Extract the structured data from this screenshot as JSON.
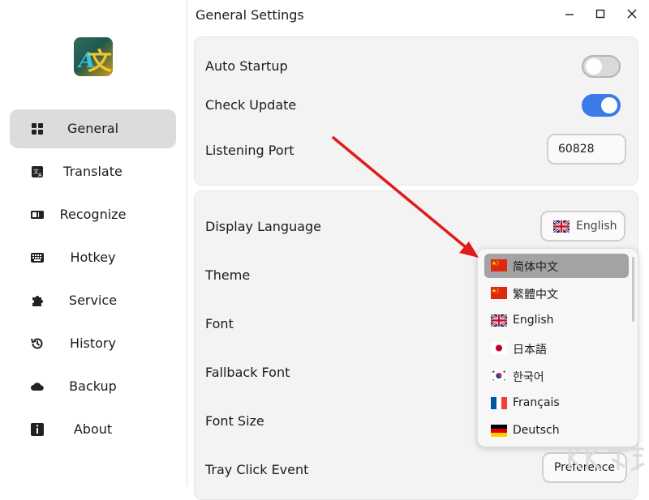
{
  "window": {
    "title": "General Settings"
  },
  "sidebar": {
    "items": [
      {
        "label": "General",
        "icon": "grid-icon",
        "active": true
      },
      {
        "label": "Translate",
        "icon": "translate-icon"
      },
      {
        "label": "Recognize",
        "icon": "recognize-icon"
      },
      {
        "label": "Hotkey",
        "icon": "keyboard-icon"
      },
      {
        "label": "Service",
        "icon": "puzzle-icon"
      },
      {
        "label": "History",
        "icon": "history-icon"
      },
      {
        "label": "Backup",
        "icon": "cloud-icon"
      },
      {
        "label": "About",
        "icon": "info-icon"
      }
    ]
  },
  "general": {
    "auto_startup": {
      "label": "Auto Startup",
      "enabled": false
    },
    "check_update": {
      "label": "Check Update",
      "enabled": true
    },
    "listening_port": {
      "label": "Listening Port",
      "value": "60828"
    }
  },
  "appearance": {
    "display_language": {
      "label": "Display Language",
      "value": "English"
    },
    "theme": {
      "label": "Theme"
    },
    "font": {
      "label": "Font"
    },
    "fallback_font": {
      "label": "Fallback Font"
    },
    "font_size": {
      "label": "Font Size"
    },
    "tray_click_event": {
      "label": "Tray Click Event",
      "value": "Preference"
    }
  },
  "language_dropdown": {
    "options": [
      {
        "label": "简体中文",
        "flag": "cn",
        "selected": true
      },
      {
        "label": "繁體中文",
        "flag": "cn"
      },
      {
        "label": "English",
        "flag": "gb"
      },
      {
        "label": "日本語",
        "flag": "jp"
      },
      {
        "label": "한국어",
        "flag": "kr"
      },
      {
        "label": "Français",
        "flag": "fr"
      },
      {
        "label": "Deutsch",
        "flag": "de"
      }
    ]
  },
  "colors": {
    "accent": "#3a7be8",
    "annotation_arrow": "#e01b1b"
  }
}
